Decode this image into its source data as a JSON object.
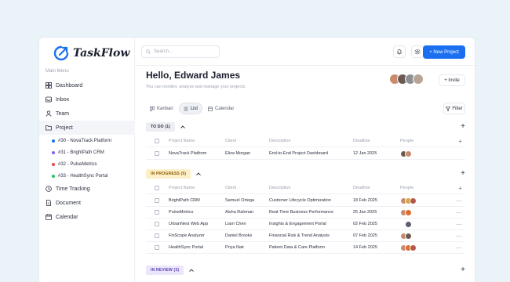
{
  "app": {
    "logo_text": "TaskFlow",
    "menu_title": "Main Menu"
  },
  "sidebar": {
    "items": [
      {
        "label": "Dashboard",
        "icon": "dashboard-icon"
      },
      {
        "label": "Inbox",
        "icon": "inbox-icon"
      },
      {
        "label": "Team",
        "icon": "team-icon"
      },
      {
        "label": "Project",
        "icon": "folder-icon"
      },
      {
        "label": "Time Tracking",
        "icon": "clock-icon"
      },
      {
        "label": "Document",
        "icon": "document-icon"
      },
      {
        "label": "Calendar",
        "icon": "calendar-icon"
      }
    ],
    "projects": [
      {
        "label": "#30 - NovaTrack Platform",
        "color": "#1a6ff0"
      },
      {
        "label": "#31 - BrightPath CRM",
        "color": "#8b5cf6"
      },
      {
        "label": "#32 - PulseMetrics",
        "color": "#ef4444"
      },
      {
        "label": "#33 - HealthSync Portal",
        "color": "#22c55e"
      }
    ]
  },
  "topbar": {
    "search_placeholder": "Search...",
    "new_project": "+ New Project"
  },
  "header": {
    "greeting": "Hello, Edward James",
    "subtitle": "You can monitor, analyze and manage your projects",
    "invite": "+ Invite"
  },
  "views": {
    "kanban": "Kanban",
    "list": "List",
    "calendar": "Calendar",
    "filter": "Filter"
  },
  "columns": {
    "name": "Project Name",
    "client": "Client",
    "desc": "Description",
    "deadline": "Deadline",
    "people": "People"
  },
  "groups": {
    "todo": {
      "label": "TO DO (1)",
      "color": "#eceef1",
      "text_color": "#2b3040",
      "rows": [
        {
          "name": "NovaTrack Platform",
          "client": "Eliza Morgan",
          "desc": "End-to-End Project Dashboard",
          "deadline": "12 Jan 2025"
        }
      ]
    },
    "inprogress": {
      "label": "IN PROGRESS (5)",
      "color": "#fdf0c8",
      "text_color": "#8a5a00",
      "rows": [
        {
          "name": "BrightPath CRM",
          "client": "Samuel Ortega",
          "desc": "Customer Lifecycle Optimization",
          "deadline": "18 Feb 2025"
        },
        {
          "name": "PulseMetrics",
          "client": "Aisha Rahman",
          "desc": "Real-Time Business Performance",
          "deadline": "25 Jan 2025"
        },
        {
          "name": "UrbanNest Web App",
          "client": "Liam Chen",
          "desc": "Insights & Engagement Portal",
          "deadline": "02 Feb 2025"
        },
        {
          "name": "FinScope Analyzer",
          "client": "Daniel Brooks",
          "desc": "Financial Risk & Trend Analysis",
          "deadline": "07 Feb 2025"
        },
        {
          "name": "HealthSync Portal",
          "client": "Priya Nair",
          "desc": "Patient Data & Care Platform",
          "deadline": "14 Feb 2025"
        }
      ]
    },
    "inreview": {
      "label": "IN REVIEW (3)",
      "color": "#ece6fb",
      "text_color": "#5b3fb0"
    }
  }
}
